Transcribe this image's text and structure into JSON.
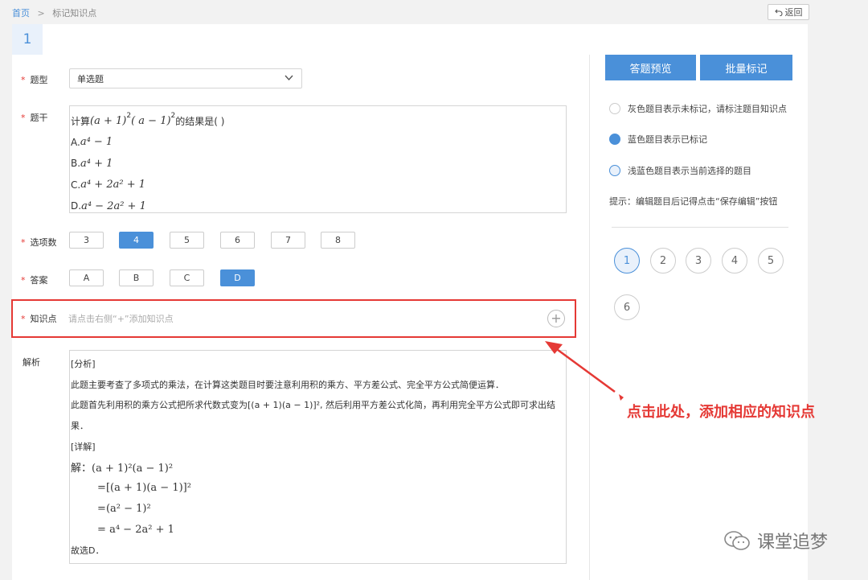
{
  "breadcrumb": {
    "home": "首页",
    "separator": ">",
    "current": "标记知识点"
  },
  "back_button": {
    "icon": "undo-icon",
    "label": "返回"
  },
  "question_tab": "1",
  "form": {
    "type_label": "题型",
    "type_value": "单选题",
    "stem_label": "题干",
    "stem": {
      "lines": [
        {
          "prefix": "计算",
          "math": "(a + 1)",
          "sup1": "2",
          "mid": "( a − 1)",
          "sup2": "2",
          "suffix": "的结果是(    )"
        },
        {
          "prefix": "A.",
          "math": "a⁴ − 1"
        },
        {
          "prefix": "B.",
          "math": "a⁴ + 1"
        },
        {
          "prefix": "C.",
          "math": "a⁴ + 2a² + 1"
        },
        {
          "prefix": "D.",
          "math": "a⁴ − 2a² + 1"
        }
      ]
    },
    "option_count_label": "选项数",
    "option_counts": [
      "3",
      "4",
      "5",
      "6",
      "7",
      "8"
    ],
    "option_count_selected": "4",
    "answer_label": "答案",
    "answers": [
      "A",
      "B",
      "C",
      "D"
    ],
    "answer_selected": "D",
    "knowledge_label": "知识点",
    "knowledge_placeholder": "请点击右侧“+”添加知识点",
    "analysis_label": "解析",
    "analysis_lines": [
      "[分析]",
      "此题主要考查了多项式的乘法，在计算这类题目时要注意利用积的乘方、平方差公式、完全平方公式简便运算．",
      "此题首先利用积的乘方公式把所求代数式变为[(a + 1)(a − 1)]², 然后利用平方差公式化简，再利用完全平方公式即可求出结",
      "果．",
      "[详解]",
      "解：(a + 1)²(a − 1)²",
      "        =[(a + 1)(a − 1)]²",
      "        =(a² − 1)²",
      "        = a⁴ − 2a² + 1",
      "故选D．"
    ]
  },
  "sidebar": {
    "preview_button": "答题预览",
    "batch_button": "批量标记",
    "legend": [
      {
        "text": "灰色题目表示未标记，请标注题目知识点",
        "color": "#ffffff",
        "border": "#cccccc"
      },
      {
        "text": "蓝色题目表示已标记",
        "color": "#4a90d9",
        "border": "#4a90d9"
      },
      {
        "text": "浅蓝色题目表示当前选择的题目",
        "color": "#e9f1fb",
        "border": "#4a90d9"
      }
    ],
    "hint": "提示：编辑题目后记得点击“保存编辑”按钮",
    "question_numbers": [
      "1",
      "2",
      "3",
      "4",
      "5",
      "6"
    ],
    "current_question": "1"
  },
  "annotation": "点击此处，添加相应的知识点",
  "watermark": "课堂追梦",
  "colors": {
    "accent": "#4a90d9",
    "annotation_red": "#e53935"
  }
}
